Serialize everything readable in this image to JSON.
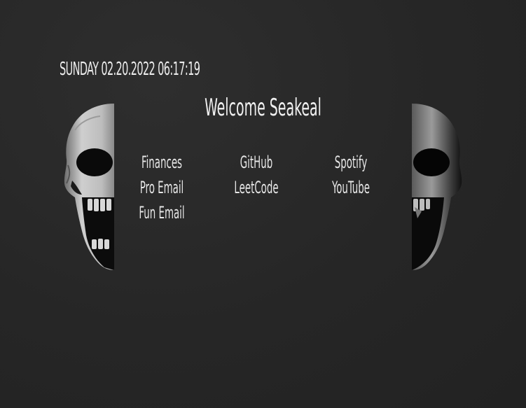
{
  "header": {
    "datetime": "SUNDAY 02.20.2022 06:17:19",
    "welcome": "Welcome Seakeal"
  },
  "links": {
    "col1": [
      "Finances",
      "Pro Email",
      "Fun Email"
    ],
    "col2": [
      "GitHub",
      "LeetCode"
    ],
    "col3": [
      "Spotify",
      "YouTube"
    ]
  },
  "colors": {
    "background": "#262626",
    "text": "#e9e9e9"
  },
  "icons": {
    "left": "skull-left-half-icon",
    "right": "skull-right-half-icon"
  }
}
